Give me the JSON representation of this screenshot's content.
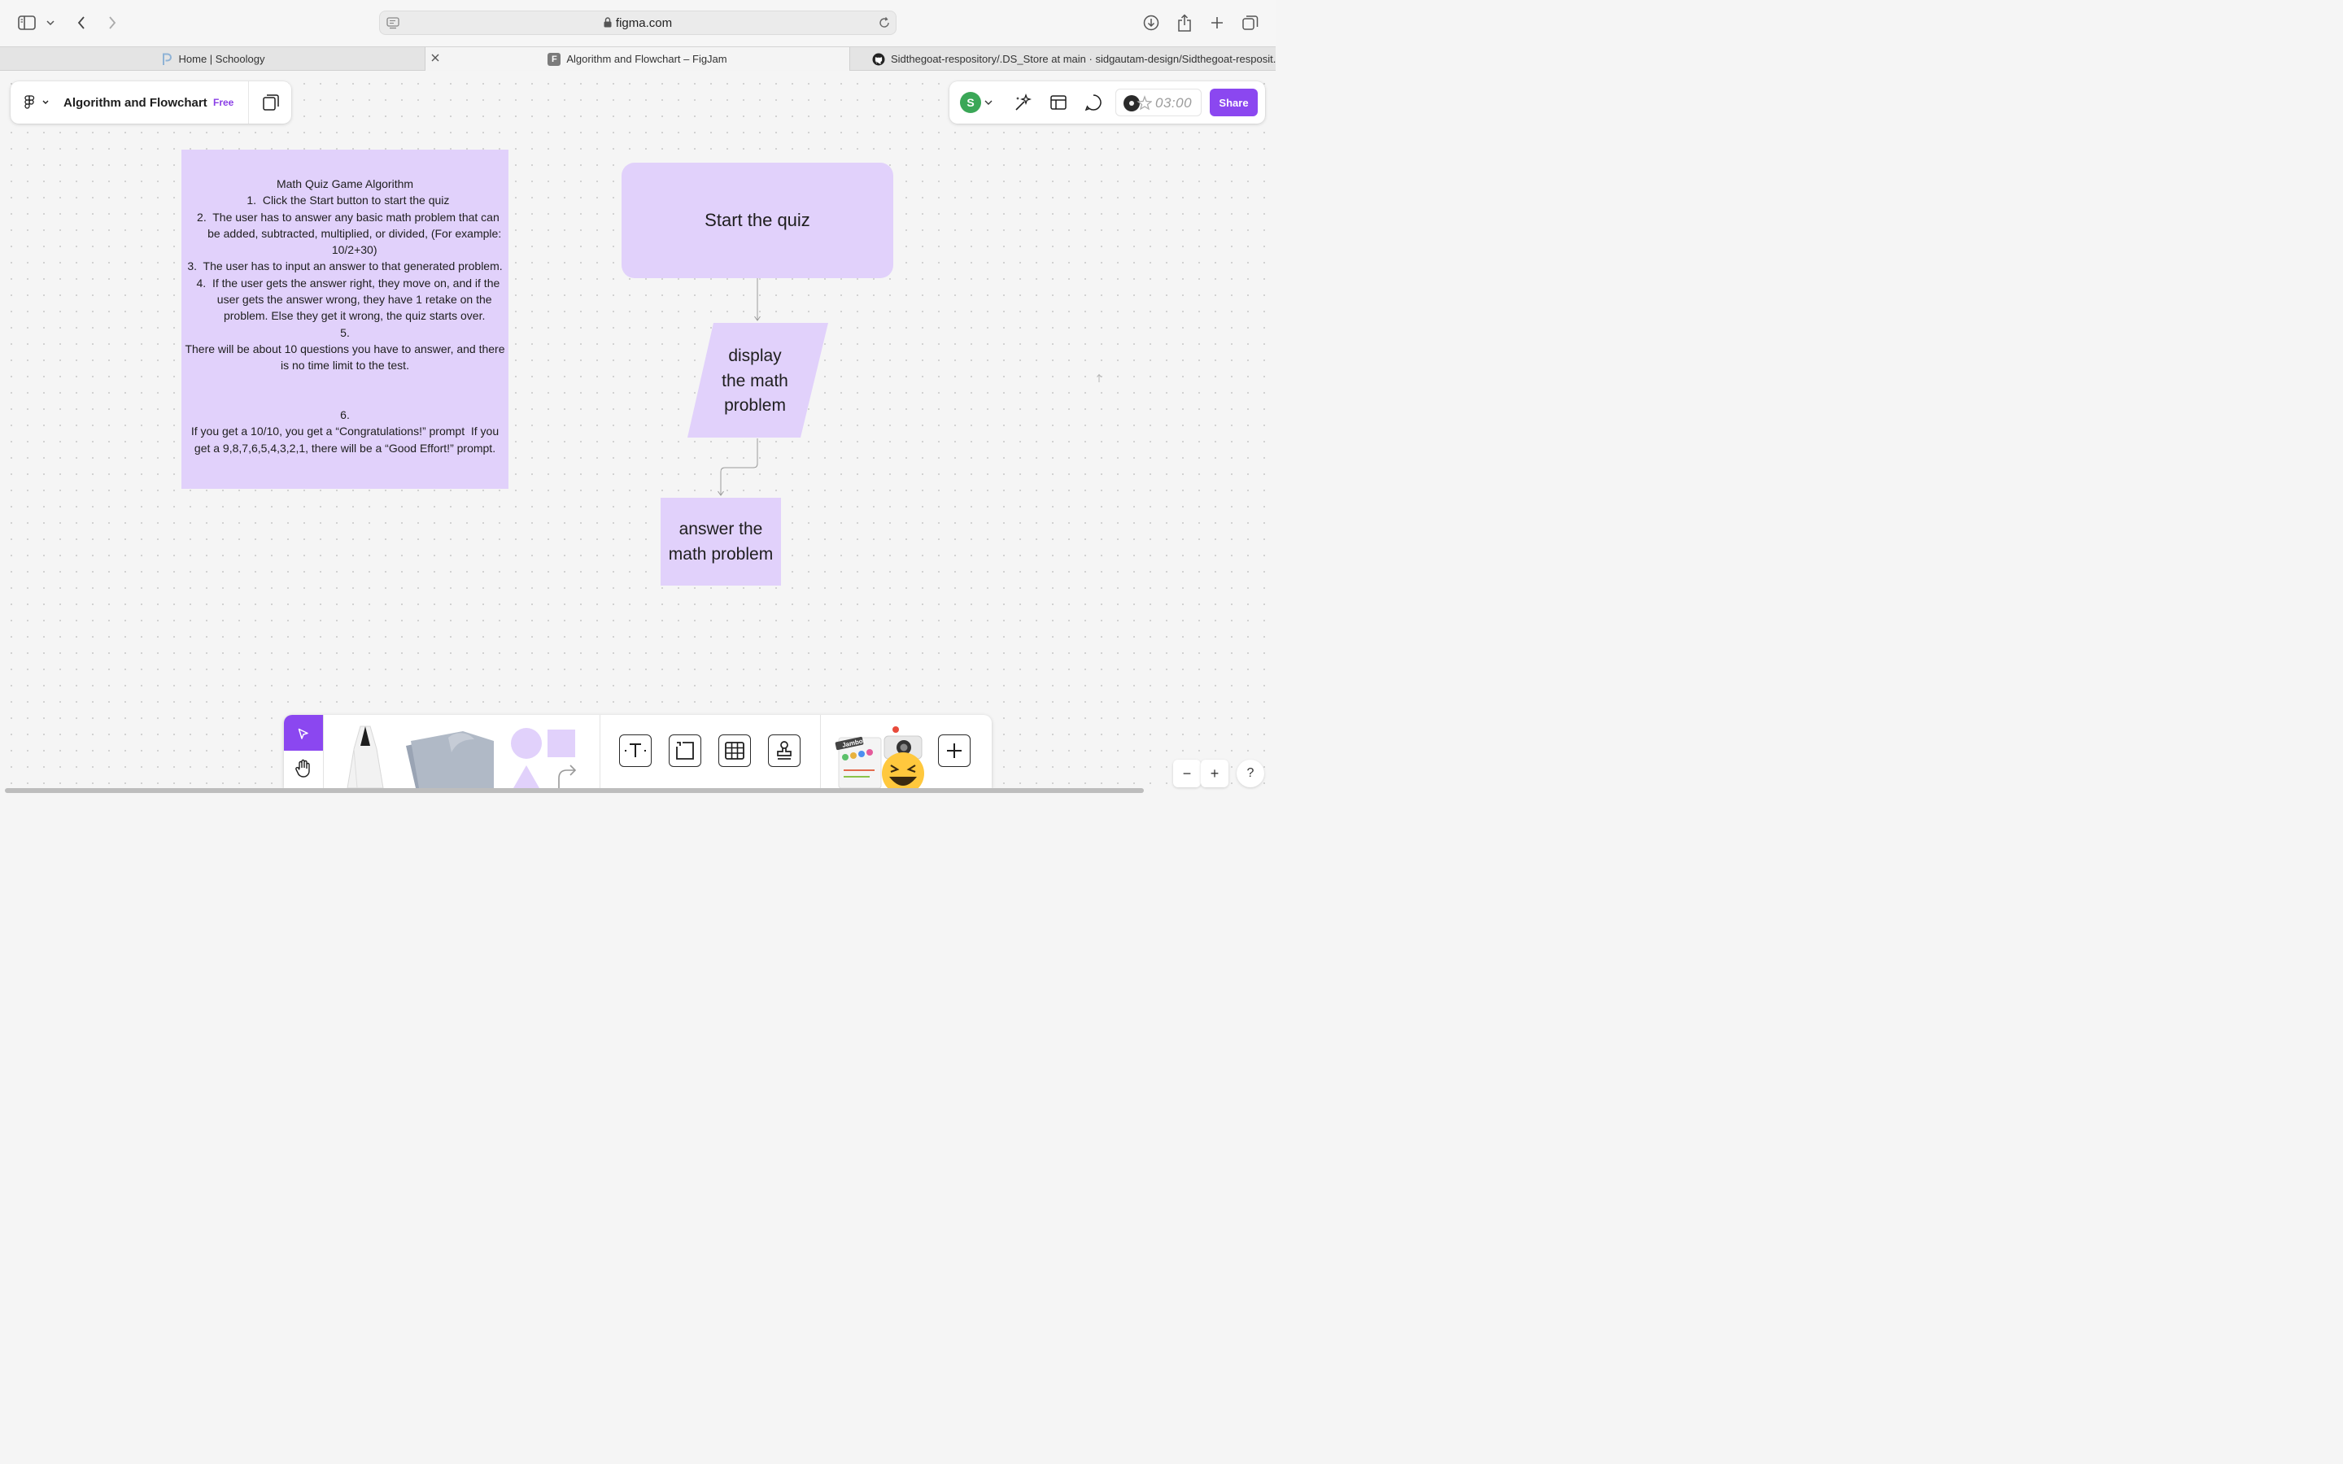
{
  "browser": {
    "url": "figma.com",
    "tabs": [
      {
        "title": "Home | Schoology",
        "active": false
      },
      {
        "title": "Algorithm and Flowchart – FigJam",
        "active": true
      },
      {
        "title": "Sidthegoat-respository/.DS_Store at main · sidgautam-design/Sidthegoat-resposit...",
        "active": false
      }
    ],
    "favicon_figma_letter": "F"
  },
  "file": {
    "title": "Algorithm and Flowchart",
    "plan": "Free"
  },
  "toolbar_right": {
    "avatar_initial": "S",
    "avatar_color": "#3aa757",
    "timer": "03:00",
    "share_label": "Share",
    "accent": "#8b47f0"
  },
  "algorithm_note": {
    "text": "Math Quiz Game Algorithm\n  1.  Click the Start button to start the quiz\n  2.  The user has to answer any basic math problem that can\n      be added, subtracted, multiplied, or divided, (For example:\n      10/2+30)\n3.  The user has to input an answer to that generated problem.\n  4.  If the user gets the answer right, they move on, and if the\n      user gets the answer wrong, they have 1 retake on the\n      problem. Else they get it wrong, the quiz starts over.\n5.\nThere will be about 10 questions you have to answer, and there\nis no time limit to the test.\n\n\n6.\nIf you get a 10/10, you get a “Congratulations!” prompt  If you\nget a 9,8,7,6,5,4,3,2,1, there will be a “Good Effort!” prompt.",
    "fill": "#e1d1fb"
  },
  "flowchart": {
    "start": "Start the quiz",
    "display_lines": [
      "display",
      "the math",
      "problem"
    ],
    "answer_lines": [
      "answer the",
      "math problem"
    ]
  },
  "bottom_toolbar": {
    "sticker_label": "Jambot"
  },
  "zoom": {
    "minus": "−",
    "plus": "+",
    "help": "?"
  }
}
